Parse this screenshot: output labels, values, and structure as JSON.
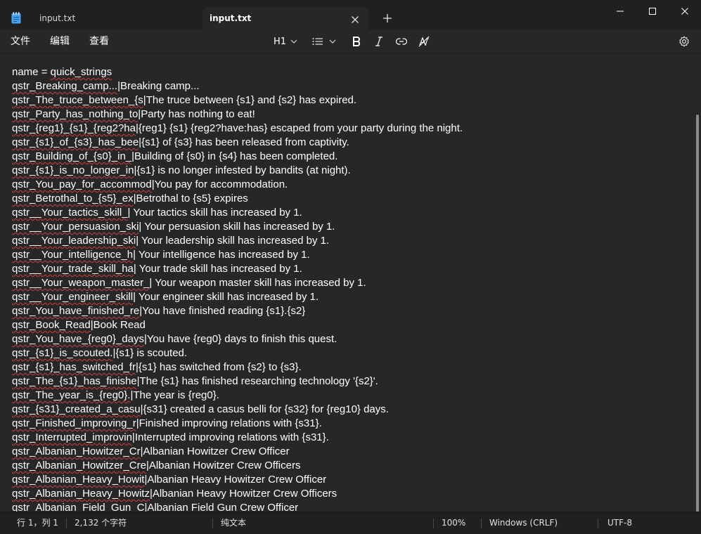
{
  "window": {
    "tabs": [
      {
        "label": "input.txt",
        "active": false
      },
      {
        "label": "input.txt",
        "active": true
      }
    ],
    "controls": [
      "minimize-icon",
      "maximize-icon",
      "close-icon"
    ]
  },
  "menu": {
    "items": [
      "文件",
      "编辑",
      "查看"
    ]
  },
  "toolbar": {
    "heading_label": "H1",
    "icons": [
      "chevron-down-icon",
      "list-icon",
      "bold-icon",
      "italic-icon",
      "link-icon",
      "clear-format-icon",
      "gear-icon"
    ]
  },
  "editor": {
    "lines": [
      [
        "name = ",
        "quick_strings",
        ""
      ],
      [
        "",
        "qstr_Breaking_camp...",
        "|Breaking camp..."
      ],
      [
        "",
        "qstr_The_truce_between_{s",
        "|The truce between {s1} and {s2} has expired."
      ],
      [
        "",
        "qstr_Party_has_nothing_to",
        "|Party has nothing to eat!"
      ],
      [
        "",
        "qstr_{reg1}_{s1}_{reg2?ha",
        "|{reg1} {s1} {reg2?have:has} escaped from your party during the night."
      ],
      [
        "",
        "qstr_{s1}_of_{s3}_has_bee",
        "|{s1} of {s3} has been released from captivity."
      ],
      [
        "",
        "qstr_Building_of_{s0}_in_",
        "|Building of {s0} in {s4} has been completed."
      ],
      [
        "",
        "qstr_{s1}_is_no_longer_in",
        "|{s1} is no longer infested by bandits (at night)."
      ],
      [
        "",
        "qstr_You_pay_for_accommod",
        "|You pay for accommodation."
      ],
      [
        "",
        "qstr_Betrothal_to_{s5}_ex",
        "|Betrothal to {s5} expires"
      ],
      [
        "",
        "qstr__Your_tactics_skill_",
        "| Your tactics skill has increased by 1."
      ],
      [
        "",
        "qstr__Your_persuasion_ski",
        "| Your persuasion skill has increased by 1."
      ],
      [
        "",
        "qstr__Your_leadership_ski",
        "| Your leadership skill has increased by 1."
      ],
      [
        "",
        "qstr__Your_intelligence_h",
        "| Your intelligence has increased by 1."
      ],
      [
        "",
        "qstr__Your_trade_skill_ha",
        "| Your trade skill has increased by 1."
      ],
      [
        "",
        "qstr__Your_weapon_master_",
        "| Your weapon master skill has increased by 1."
      ],
      [
        "",
        "qstr__Your_engineer_skill",
        "| Your engineer skill has increased by 1."
      ],
      [
        "",
        "qstr_You_have_finished_re",
        "|You have finished reading {s1}.{s2}"
      ],
      [
        "",
        "qstr_Book_Read",
        "|Book Read"
      ],
      [
        "",
        "qstr_You_have_{reg0}_days",
        "|You have {reg0} days to finish this quest."
      ],
      [
        "",
        "qstr_{s1}_is_scouted.",
        "|{s1} is scouted."
      ],
      [
        "",
        "qstr_{s1}_has_switched_fr",
        "|{s1} has switched from {s2} to {s3}."
      ],
      [
        "",
        "qstr_The_{s1}_has_finishe",
        "|The {s1} has finished researching technology '{s2}'."
      ],
      [
        "",
        "qstr_The_year_is_{reg0}.",
        "|The year is {reg0}."
      ],
      [
        "",
        "qstr_{s31}_created_a_casu",
        "|{s31} created a casus belli for {s32} for {reg10} days."
      ],
      [
        "",
        "qstr_Finished_improving_r",
        "|Finished improving relations with {s31}."
      ],
      [
        "",
        "qstr_Interrupted_improvin",
        "|Interrupted improving relations with {s31}."
      ],
      [
        "",
        "qstr_Albanian_Howitzer_Cr",
        "|Albanian Howitzer Crew Officer"
      ],
      [
        "",
        "qstr_Albanian_Howitzer_Cre",
        "|Albanian Howitzer Crew Officers"
      ],
      [
        "",
        "qstr_Albanian_Heavy_Howit",
        "|Albanian Heavy Howitzer Crew Officer"
      ],
      [
        "",
        "qstr_Albanian_Heavy_Howitz",
        "|Albanian Heavy Howitzer Crew Officers"
      ],
      [
        "",
        "qstr_Albanian_Field_Gun_C",
        "|Albanian Field Gun Crew Officer"
      ]
    ]
  },
  "status": {
    "position": "行 1，列 1",
    "char_count": "2,132 个字符",
    "format": "纯文本",
    "zoom": "100%",
    "line_ending": "Windows (CRLF)",
    "encoding": "UTF-8"
  },
  "colors": {
    "accent": "#4aa3f0",
    "spellcheck_squiggle": "#d33b3b"
  }
}
